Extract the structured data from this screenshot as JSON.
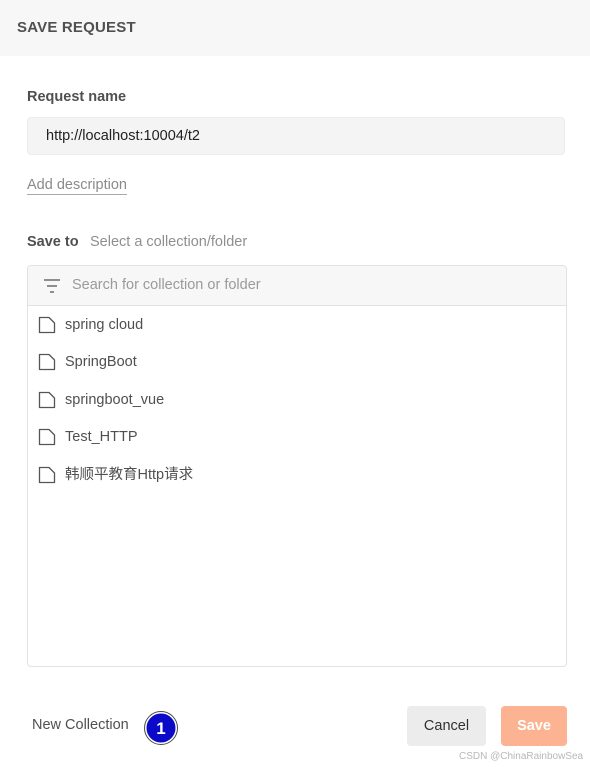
{
  "header": {
    "title": "SAVE REQUEST"
  },
  "request_name": {
    "label": "Request name",
    "value": "http://localhost:10004/t2"
  },
  "add_description": "Add description",
  "save_to": {
    "label": "Save to",
    "path_placeholder": "Select a collection/folder"
  },
  "search": {
    "placeholder": "Search for collection or folder",
    "icon": "filter-icon"
  },
  "collections": [
    {
      "label": "spring cloud",
      "icon": "folder-icon"
    },
    {
      "label": "SpringBoot",
      "icon": "folder-icon"
    },
    {
      "label": "springboot_vue",
      "icon": "folder-icon"
    },
    {
      "label": "Test_HTTP",
      "icon": "folder-icon"
    },
    {
      "label": "韩顺平教育Http请求",
      "icon": "folder-icon"
    }
  ],
  "footer": {
    "new_collection": "New Collection",
    "annotation_number": "1",
    "cancel": "Cancel",
    "save": "Save"
  },
  "colors": {
    "save_button": "#fbb391",
    "annotation_badge": "#0a0ac8",
    "header_bg": "#f7f7f7"
  },
  "watermark": "CSDN @ChinaRainbowSea"
}
